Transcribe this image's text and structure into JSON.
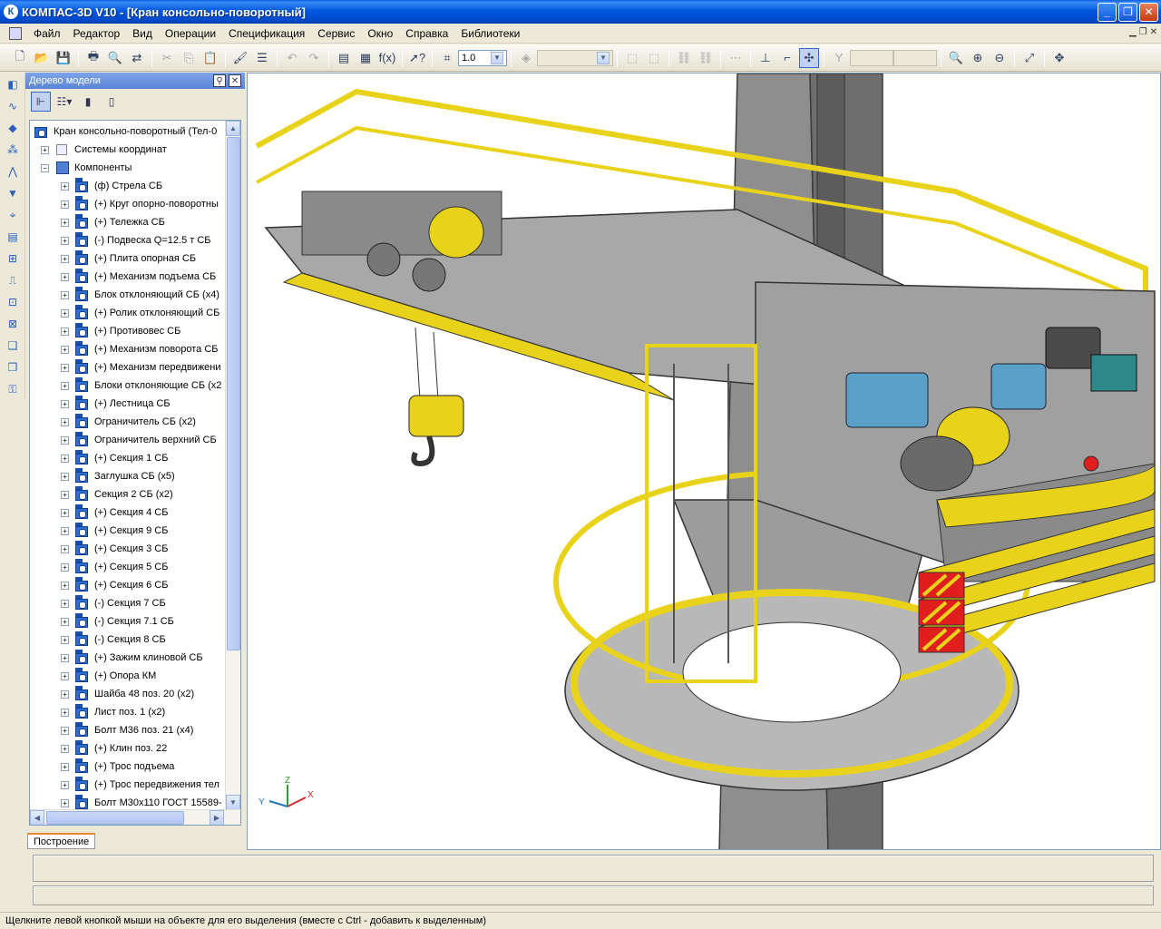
{
  "window": {
    "title": "КОМПАС-3D V10 - [Кран консольно-поворотный]",
    "app_icon": "kompas-logo-icon"
  },
  "menu": [
    "Файл",
    "Редактор",
    "Вид",
    "Операции",
    "Спецификация",
    "Сервис",
    "Окно",
    "Справка",
    "Библиотеки"
  ],
  "toolbar": {
    "scale_value": "1.0",
    "icons": [
      "new-icon",
      "open-icon",
      "save-icon",
      "print-icon",
      "print-preview-icon",
      "cut-icon",
      "copy-icon",
      "paste-icon",
      "format-painter-icon",
      "undo-icon",
      "redo-icon",
      "variables-icon",
      "fx-icon",
      "help-icon",
      "zoom-icon",
      "rotate-icon",
      "pan-icon"
    ]
  },
  "tree_panel": {
    "title": "Дерево модели",
    "root": "Кран консольно-поворотный (Тел-0",
    "groups": [
      "Системы координат",
      "Компоненты"
    ],
    "components": [
      "(ф) Стрела СБ",
      "(+) Круг опорно-поворотны",
      "(+) Тележка СБ",
      "(-) Подвеска Q=12.5 т СБ",
      "(+) Плита опорная СБ",
      "(+) Механизм подъема СБ",
      "Блок отклоняющий СБ (x4)",
      "(+) Ролик отклоняющий СБ",
      "(+) Противовес СБ",
      "(+) Механизм поворота СБ",
      "(+) Механизм передвижени",
      "Блоки отклоняющие СБ (x2",
      "(+) Лестница СБ",
      "Ограничитель СБ (x2)",
      "Ограничитель верхний СБ",
      "(+) Секция 1 СБ",
      "Заглушка СБ (x5)",
      "Секция 2 СБ (x2)",
      "(+) Секция 4 СБ",
      "(+) Секция 9 СБ",
      "(+) Секция 3 СБ",
      "(+) Секция 5 СБ",
      "(+) Секция 6 СБ",
      "(-) Секция 7 СБ",
      "(-) Секция 7.1 СБ",
      "(-) Секция 8 СБ",
      "(+) Зажим клиновой СБ",
      "(+) Опора КМ",
      "Шайба 48 поз. 20 (x2)",
      "Лист поз. 1 (x2)",
      "Болт М36 поз. 21 (x4)",
      "(+) Клин поз. 22",
      "(+) Трос подъема",
      "(+) Трос передвижения тел",
      "Болт М30х110 ГОСТ 15589-"
    ],
    "bottom_tab": "Построение"
  },
  "axes": {
    "x": "X",
    "y": "Y",
    "z": "Z"
  },
  "status": "Щелкните левой кнопкой мыши на объекте для его выделения (вместе с Ctrl - добавить к выделенным)",
  "colors": {
    "steel": "#9a9a9a",
    "rail": "#e8d21a",
    "warning": "#e01e1e",
    "motor": "#5aa0c8",
    "accent_title": "#0058e0"
  }
}
